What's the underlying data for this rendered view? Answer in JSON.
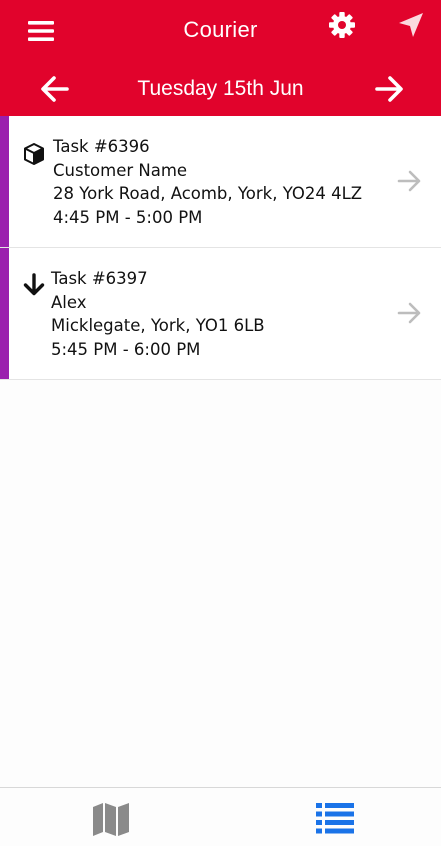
{
  "header": {
    "title": "Courier",
    "date": "Tuesday 15th Jun",
    "background_color": "#e1032c",
    "icons": [
      "menu-icon",
      "gear-icon",
      "navigation-icon",
      "arrow-left-icon",
      "arrow-right-icon"
    ]
  },
  "tasks": [
    {
      "task_id": "Task #6396",
      "name": "Customer Name",
      "address": "28 York Road, Acomb, York, YO24 4LZ",
      "time": "4:45 PM - 5:00 PM",
      "type_icon": "package-icon",
      "accent_color": "#9b1fae"
    },
    {
      "task_id": "Task #6397",
      "name": "Alex",
      "address": "Micklegate, York, YO1 6LB",
      "time": "5:45 PM - 6:00 PM",
      "type_icon": "arrow-down-icon",
      "accent_color": "#9b1fae"
    }
  ],
  "bottom_nav": {
    "tabs": [
      {
        "icon": "map-icon",
        "active": false,
        "color": "#8a8a8a"
      },
      {
        "icon": "list-icon",
        "active": true,
        "color": "#1a73e8"
      }
    ]
  }
}
